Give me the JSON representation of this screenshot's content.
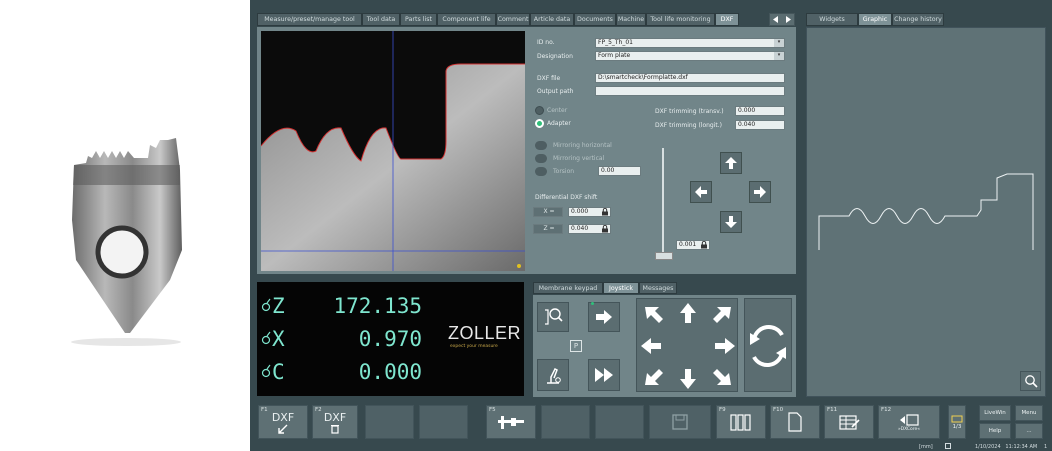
{
  "top_tabs": [
    {
      "label": "Measure/preset/manage tool",
      "active": false
    },
    {
      "label": "Tool data",
      "active": false
    },
    {
      "label": "Parts list",
      "active": false
    },
    {
      "label": "Component life",
      "active": false
    },
    {
      "label": "Comment",
      "active": false
    },
    {
      "label": "Article data",
      "active": false
    },
    {
      "label": "Documents",
      "active": false
    },
    {
      "label": "Machine",
      "active": false
    },
    {
      "label": "Tool life monitoring",
      "active": false
    },
    {
      "label": "DXF",
      "active": true
    }
  ],
  "right_tabs": [
    {
      "label": "Widgets",
      "active": false
    },
    {
      "label": "Graphic",
      "active": true
    },
    {
      "label": "Change history",
      "active": false
    }
  ],
  "form": {
    "id_no_label": "ID no.",
    "id_no_value": "FP_5_Th_01",
    "designation_label": "Designation",
    "designation_value": "Form plate",
    "dxf_file_label": "DXF file",
    "dxf_file_value": "D:\\smartcheck\\Formplatte.dxf",
    "output_path_label": "Output path",
    "output_path_value": "",
    "center_label": "Center",
    "adapter_label": "Adapter",
    "dxf_trim_trans_label": "DXF trimming (transv.)",
    "dxf_trim_trans_value": "0.000",
    "dxf_trim_longit_label": "DXF trimming (longit.)",
    "dxf_trim_longit_value": "0.040",
    "mirroring_h_label": "Mirroring horizontal",
    "mirroring_v_label": "Mirroring vertical",
    "torsion_label": "Torsion",
    "torsion_value": "0.00",
    "diff_shift_label": "Differential DXF shift",
    "x_label": "X =",
    "x_value": "0.000",
    "z_label": "Z =",
    "z_value": "0.040",
    "slider_value": "0.001"
  },
  "readout": {
    "z_label": "Z",
    "z_value": "172.135",
    "x_label": "X",
    "x_value": "0.970",
    "c_label": "C",
    "c_value": "0.000",
    "brand": "ZOLLER",
    "tagline": "expect your measure"
  },
  "bottom_tabs": [
    {
      "label": "Membrane keypad",
      "active": false
    },
    {
      "label": "Joystick",
      "active": true
    },
    {
      "label": "Messages",
      "active": false
    }
  ],
  "joystick": {
    "p_label": "P"
  },
  "fkeys": [
    {
      "num": "F1",
      "label": "DXF",
      "icon": "dxf-import-icon"
    },
    {
      "num": "F2",
      "label": "DXF",
      "icon": "dxf-delete-icon"
    },
    {
      "num": "",
      "label": "",
      "icon": ""
    },
    {
      "num": "",
      "label": "",
      "icon": ""
    },
    {
      "num": "F5",
      "label": "",
      "icon": "caliper-icon"
    },
    {
      "num": "",
      "label": "",
      "icon": ""
    },
    {
      "num": "",
      "label": "",
      "icon": ""
    },
    {
      "num": "",
      "label": "",
      "icon": "save-icon"
    },
    {
      "num": "F9",
      "label": "",
      "icon": "binders-icon"
    },
    {
      "num": "F10",
      "label": "",
      "icon": "document-icon"
    },
    {
      "num": "F11",
      "label": "",
      "icon": "table-edit-icon"
    },
    {
      "num": "F12",
      "label": "»DXCore«",
      "icon": "dxcore-icon"
    }
  ],
  "side_buttons": {
    "page": "1/3",
    "livewin": "LiveWin",
    "menu": "Menu",
    "help": "Help",
    "more": "..."
  },
  "status": {
    "unit": "[mm]",
    "datetime": "1/10/2024   11:12:34 AM",
    "datetime_suffix": "1"
  },
  "colors": {
    "accent_green": "#2fbf7a",
    "readout_text": "#7fe6cf",
    "panel_bg": "#718589"
  }
}
